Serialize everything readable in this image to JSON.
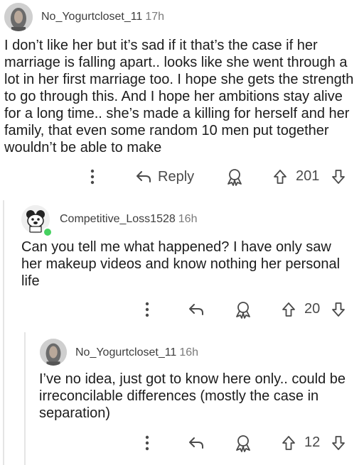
{
  "comments": [
    {
      "username": "No_Yogurtcloset_11",
      "time": "17h",
      "body": "I don’t like her but it’s sad if it that’s the case if her marriage is falling apart.. looks like she went through a lot in her first marriage too. I hope she gets the strength to go through this. And I hope her ambitions stay alive for a long time.. she’s made a killing for herself and her family, that even some random 10 men put together wouldn’t be able to make",
      "reply_label": "Reply",
      "score": "201"
    },
    {
      "username": "Competitive_Loss1528",
      "time": "16h",
      "body": "Can you tell me what happened? I have only saw her makeup videos and know nothing her personal life",
      "score": "20"
    },
    {
      "username": "No_Yogurtcloset_11",
      "time": "16h",
      "body": "I’ve no idea, just got to know here only.. could be irreconcilable differences (mostly the case in separation)",
      "score": "12"
    }
  ],
  "colors": {
    "thread_line": "#e5e5e5",
    "text": "#1c1c1c",
    "meta": "#7a7a7a",
    "online": "#46d160"
  }
}
